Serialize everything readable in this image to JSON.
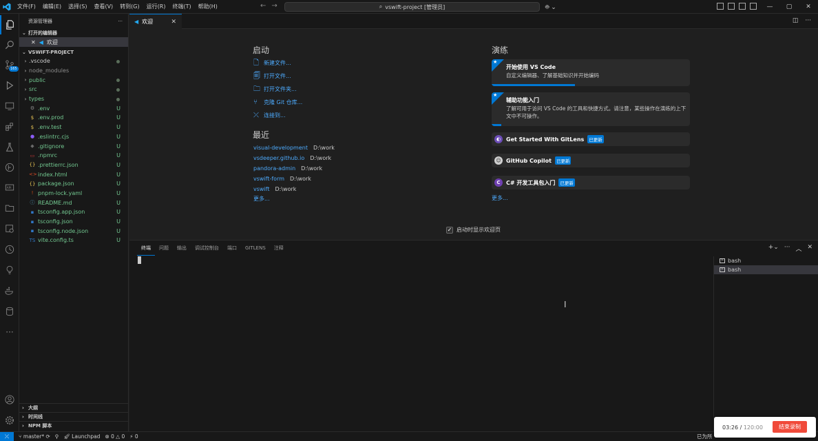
{
  "titlebar": {
    "menu": [
      "文件(F)",
      "编辑(E)",
      "选择(S)",
      "查看(V)",
      "转到(G)",
      "运行(R)",
      "终端(T)",
      "帮助(H)"
    ],
    "search_text": "vswift-project [管理员]",
    "accent": "#0078d4"
  },
  "activity": {
    "scm_badge": "165"
  },
  "sidebar": {
    "title": "资源管理器",
    "more": "···",
    "open_editors": "打开的编辑器",
    "open_file": "欢迎",
    "project": "VSWIFT-PROJECT",
    "tree": [
      {
        "chev": "›",
        "icon": "",
        "name": ".vscode",
        "status": "",
        "dot": true,
        "color": "#cccccc"
      },
      {
        "chev": "›",
        "icon": "",
        "name": "node_modules",
        "status": "",
        "dot": false,
        "color": "#8c8c8c"
      },
      {
        "chev": "›",
        "icon": "",
        "name": "public",
        "status": "",
        "dot": true,
        "color": "#73c991"
      },
      {
        "chev": "›",
        "icon": "",
        "name": "src",
        "status": "",
        "dot": true,
        "color": "#73c991"
      },
      {
        "chev": "›",
        "icon": "",
        "name": "types",
        "status": "",
        "dot": true,
        "color": "#73c991"
      },
      {
        "chev": "",
        "icon": "⚙",
        "icon_color": "#8c8c8c",
        "name": ".env",
        "status": "U",
        "dot": false,
        "color": "#73c991"
      },
      {
        "chev": "",
        "icon": "$",
        "icon_color": "#e8c454",
        "name": ".env.prod",
        "status": "U",
        "dot": false,
        "color": "#73c991"
      },
      {
        "chev": "",
        "icon": "$",
        "icon_color": "#e8c454",
        "name": ".env.test",
        "status": "U",
        "dot": false,
        "color": "#73c991"
      },
      {
        "chev": "",
        "icon": "●",
        "icon_color": "#8b5cf6",
        "name": ".eslintrc.cjs",
        "status": "U",
        "dot": false,
        "color": "#73c991"
      },
      {
        "chev": "",
        "icon": "◆",
        "icon_color": "#6a6a6a",
        "name": ".gitignore",
        "status": "U",
        "dot": false,
        "color": "#73c991"
      },
      {
        "chev": "",
        "icon": "▭",
        "icon_color": "#cb3837",
        "name": ".npmrc",
        "status": "U",
        "dot": false,
        "color": "#73c991"
      },
      {
        "chev": "",
        "icon": "{}",
        "icon_color": "#e8c454",
        "name": ".prettierrc.json",
        "status": "U",
        "dot": false,
        "color": "#73c991"
      },
      {
        "chev": "",
        "icon": "<>",
        "icon_color": "#e44d26",
        "name": "index.html",
        "status": "U",
        "dot": false,
        "color": "#73c991"
      },
      {
        "chev": "",
        "icon": "{}",
        "icon_color": "#e8c454",
        "name": "package.json",
        "status": "U",
        "dot": false,
        "color": "#73c991"
      },
      {
        "chev": "",
        "icon": "!",
        "icon_color": "#cb4b16",
        "name": "pnpm-lock.yaml",
        "status": "U",
        "dot": false,
        "color": "#73c991"
      },
      {
        "chev": "",
        "icon": "ⓘ",
        "icon_color": "#519aba",
        "name": "README.md",
        "status": "U",
        "dot": false,
        "color": "#73c991"
      },
      {
        "chev": "",
        "icon": "▪",
        "icon_color": "#3178c6",
        "name": "tsconfig.app.json",
        "status": "U",
        "dot": false,
        "color": "#73c991"
      },
      {
        "chev": "",
        "icon": "▪",
        "icon_color": "#3178c6",
        "name": "tsconfig.json",
        "status": "U",
        "dot": false,
        "color": "#73c991"
      },
      {
        "chev": "",
        "icon": "▪",
        "icon_color": "#3178c6",
        "name": "tsconfig.node.json",
        "status": "U",
        "dot": false,
        "color": "#73c991"
      },
      {
        "chev": "",
        "icon": "TS",
        "icon_color": "#3178c6",
        "name": "vite.config.ts",
        "status": "U",
        "dot": false,
        "color": "#73c991"
      }
    ],
    "bottom_sections": [
      "大纲",
      "时间线",
      "NPM 脚本"
    ]
  },
  "editor": {
    "tab_label": "欢迎"
  },
  "welcome": {
    "start_heading": "启动",
    "start_items": [
      "新建文件...",
      "打开文件...",
      "打开文件夹...",
      "克隆 Git 仓库...",
      "连接到..."
    ],
    "recent_heading": "最近",
    "recent": [
      {
        "name": "visual-development",
        "path": "D:\\work"
      },
      {
        "name": "vsdeeper.github.io",
        "path": "D:\\work"
      },
      {
        "name": "pandora-admin",
        "path": "D:\\work"
      },
      {
        "name": "vswift-form",
        "path": "D:\\work"
      },
      {
        "name": "vswift",
        "path": "D:\\work"
      }
    ],
    "recent_more": "更多...",
    "walk_heading": "演练",
    "walkthroughs": [
      {
        "title": "开始使用 VS Code",
        "desc": "自定义编辑器、了解基础知识并开始编码",
        "progress": 0.42
      },
      {
        "title": "辅助功能入门",
        "desc": "了解可用于访问 VS Code 的工具和快捷方式。请注意，某些操作在演练的上下文中不可操作。",
        "progress": 0.05
      }
    ],
    "extensions": [
      {
        "title": "Get Started With GitLens",
        "badge": "已更新",
        "icon_color": "#6c4db6"
      },
      {
        "title": "GitHub Copilot",
        "badge": "已更新",
        "icon_color": "#d0d0d0"
      },
      {
        "title": "C# 开发工具包入门",
        "badge": "已更新",
        "icon_color": "#6e3fb0"
      }
    ],
    "walk_more": "更多...",
    "show_on_startup": "启动时显示欢迎页",
    "show_check": "✓"
  },
  "panel": {
    "tabs": [
      "终端",
      "问题",
      "输出",
      "调试控制台",
      "端口",
      "GITLENS",
      "注释"
    ],
    "terminals": [
      "bash",
      "bash"
    ]
  },
  "statusbar": {
    "branch": "master*",
    "launchpad": "Launchpad",
    "errors": "0",
    "warnings": "0",
    "ports": "0",
    "right_text": "已为所"
  },
  "recorder": {
    "elapsed": "03:26",
    "total": "120:00",
    "stop_label": "结束录制"
  }
}
